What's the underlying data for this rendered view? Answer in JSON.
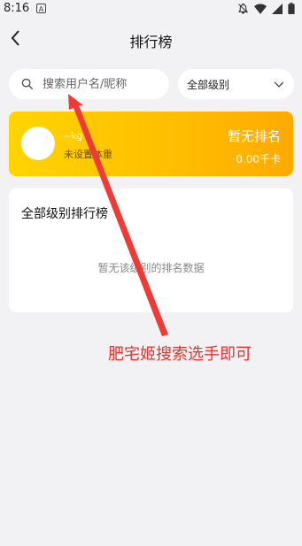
{
  "status_bar": {
    "time": "8:16",
    "app_indicator": "A"
  },
  "header": {
    "title": "排行榜",
    "back_icon": "chevron-left-icon"
  },
  "search": {
    "placeholder": "搜索用户名/昵称",
    "icon": "search-icon"
  },
  "level_select": {
    "selected": "全部级别",
    "icon": "chevron-down-icon"
  },
  "rank_card": {
    "weight": "--kg",
    "goal": "未设置体重",
    "rank_status": "暂无排名",
    "kcal": "0.00千卡",
    "gradient_colors": [
      "#ffd400",
      "#ffaa00"
    ]
  },
  "leaderboard": {
    "title": "全部级别排行榜",
    "empty_message": "暂无该级别的排名数据"
  },
  "annotation": {
    "text": "肥宅姬搜索选手即可",
    "color": "#e8322e"
  }
}
